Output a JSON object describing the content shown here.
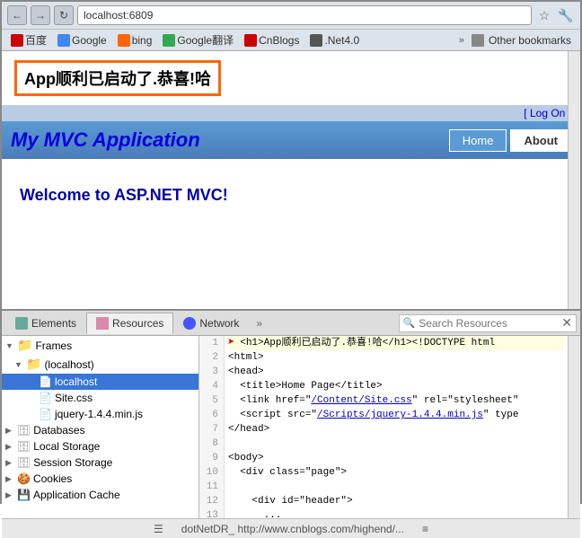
{
  "browser": {
    "back_label": "←",
    "forward_label": "→",
    "refresh_label": "↻",
    "url": "localhost:6809",
    "star_icon": "☆",
    "wrench_icon": "🔧",
    "bookmarks": [
      {
        "label": "百度",
        "color": "#c00"
      },
      {
        "label": "Google",
        "color": "#4285f4"
      },
      {
        "label": "bing",
        "color": "#ff6600"
      },
      {
        "label": "Google翻译",
        "color": "#34a853"
      },
      {
        "label": "CnBlogs",
        "color": "#c00"
      },
      {
        "label": ".Net4.0",
        "color": "#555"
      }
    ],
    "bookmark_more": "»",
    "other_bookmarks": "Other bookmarks"
  },
  "website": {
    "alert": "App顺利已启动了.恭喜!哈",
    "log_on": "[ Log On ]",
    "title": "My MVC Application",
    "nav": {
      "home": "Home",
      "about": "About"
    },
    "welcome": "Welcome to ASP.NET MVC!"
  },
  "devtools": {
    "tabs": [
      {
        "label": "Elements",
        "icon": "⚙"
      },
      {
        "label": "Resources",
        "icon": "📄"
      },
      {
        "label": "Network",
        "icon": "🌐"
      }
    ],
    "tab_more": "»",
    "search_placeholder": "Search Resources",
    "tree": {
      "frames_label": "Frames",
      "localhost_label": "(localhost)",
      "localhost_selected": "localhost",
      "sitecss_label": "Site.css",
      "jquery_label": "jquery-1.4.4.min.js",
      "databases_label": "Databases",
      "local_storage_label": "Local Storage",
      "session_storage_label": "Session Storage",
      "cookies_label": "Cookies",
      "app_cache_label": "Application Cache"
    },
    "code": {
      "lines": [
        {
          "num": 1,
          "text": "<h1>App顺利已启动了.恭喜!哈</h1><!DOCTYPE html",
          "highlighted": true,
          "arrow": true
        },
        {
          "num": 2,
          "text": "<html>"
        },
        {
          "num": 3,
          "text": "<head>"
        },
        {
          "num": 4,
          "text": "  <title>Home Page</title>"
        },
        {
          "num": 5,
          "text": "  <link href=\"/Content/Site.css\" rel=\"stylesheet\""
        },
        {
          "num": 6,
          "text": "  <script src=\"/Scripts/jquery-1.4.4.min.js\" type"
        },
        {
          "num": 7,
          "text": "</head>"
        },
        {
          "num": 8,
          "text": ""
        },
        {
          "num": 9,
          "text": "<body>"
        },
        {
          "num": 10,
          "text": "  <div class=\"page\">"
        },
        {
          "num": 11,
          "text": ""
        },
        {
          "num": 12,
          "text": "    <div id=\"header\">"
        },
        {
          "num": 13,
          "text": "      ..."
        }
      ]
    },
    "statusbar": {
      "left_icon": "☰",
      "right_icon": "≡",
      "text": "dotNetDR_   http://www.cnblogs.com/highend/..."
    }
  }
}
